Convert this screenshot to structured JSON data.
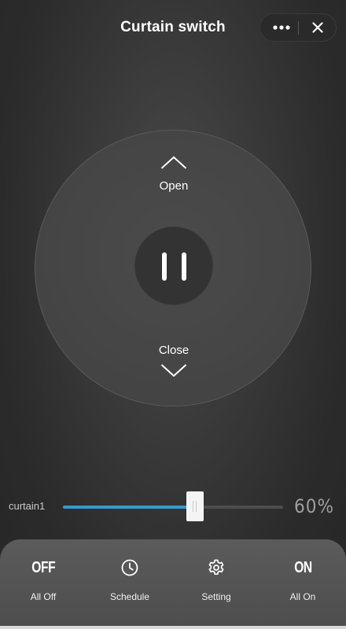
{
  "header": {
    "title": "Curtain switch",
    "more_icon": "more-horizontal-icon",
    "close_icon": "close-icon"
  },
  "dial": {
    "open_label": "Open",
    "close_label": "Close",
    "open_icon": "chevron-up-icon",
    "close_icon": "chevron-down-icon",
    "pause_icon": "pause-icon"
  },
  "slider": {
    "label": "curtain1",
    "value": 60,
    "value_text": "60%",
    "fill_color": "#3a9ac4"
  },
  "bottom_bar": {
    "items": [
      {
        "label": "All Off",
        "icon_text": "OFF"
      },
      {
        "label": "Schedule",
        "icon": "clock-icon"
      },
      {
        "label": "Setting",
        "icon": "gear-icon"
      },
      {
        "label": "All On",
        "icon_text": "ON"
      }
    ]
  },
  "colors": {
    "background": "#2b2b2b",
    "dial": "#454545",
    "bottom_bar": "#555555",
    "accent": "#3a9ac4"
  }
}
